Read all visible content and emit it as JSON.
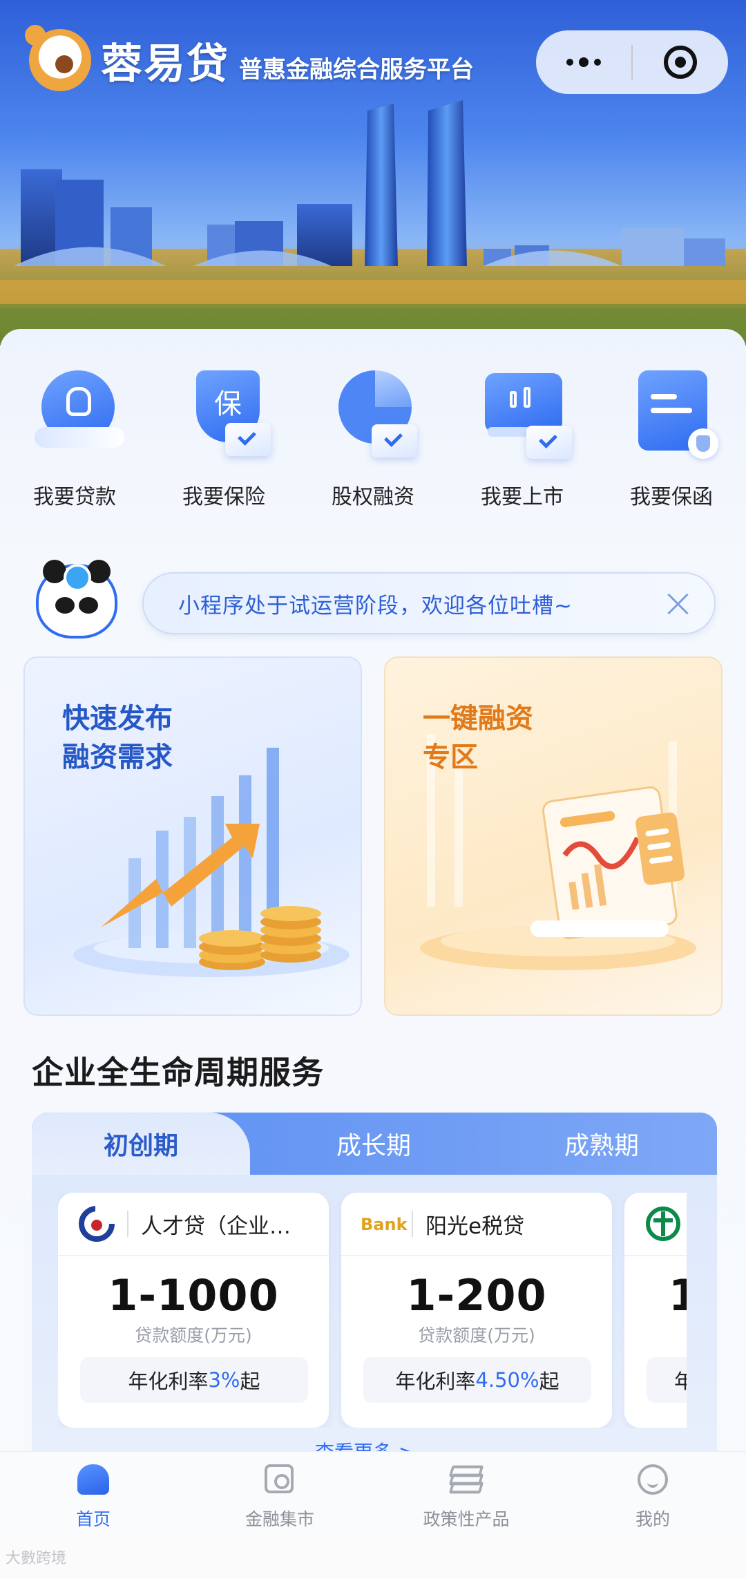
{
  "header": {
    "brand": "蓉易贷",
    "slogan": "普惠金融综合服务平台"
  },
  "capsule": {
    "more_icon": "more-dots-icon",
    "close_icon": "target-circle-icon"
  },
  "quick_actions": [
    {
      "label": "我要贷款",
      "icon": "money-bag-hand-icon"
    },
    {
      "label": "我要保险",
      "icon": "insurance-shield-icon"
    },
    {
      "label": "股权融资",
      "icon": "pie-chart-icon"
    },
    {
      "label": "我要上市",
      "icon": "stock-screen-icon"
    },
    {
      "label": "我要保函",
      "icon": "guarantee-doc-icon"
    }
  ],
  "notice": {
    "text": "小程序处于试运营阶段，欢迎各位吐槽~",
    "close_icon": "close-icon"
  },
  "promos": [
    {
      "title": "快速发布\n融资需求",
      "color": "#2558c6"
    },
    {
      "title": "一键融资\n专区",
      "color": "#e07a1a"
    }
  ],
  "lifecycle": {
    "title": "企业全生命周期服务",
    "tabs": [
      "初创期",
      "成长期",
      "成熟期"
    ],
    "active_tab": "初创期",
    "products": [
      {
        "name": "人才贷（企业…",
        "amount": "1-1000",
        "amount_label": "贷款额度(万元)",
        "rate_prefix": "年化利率",
        "rate": "3%",
        "rate_suffix": "起"
      },
      {
        "name": "阳光e税贷",
        "logo_text": "Bank",
        "amount": "1-200",
        "amount_label": "贷款额度(万元)",
        "rate_prefix": "年化利率",
        "rate": "4.50%",
        "rate_suffix": "起"
      },
      {
        "name": "",
        "amount": "1",
        "amount_label": "",
        "rate_prefix": "年",
        "rate": "",
        "rate_suffix": ""
      }
    ],
    "more_link": "查看更多 >"
  },
  "tabbar": [
    {
      "label": "首页",
      "icon": "home-icon",
      "active": true
    },
    {
      "label": "金融集市",
      "icon": "market-icon",
      "active": false
    },
    {
      "label": "政策性产品",
      "icon": "layers-icon",
      "active": false
    },
    {
      "label": "我的",
      "icon": "profile-icon",
      "active": false
    }
  ],
  "watermark": "大數跨境",
  "colors": {
    "accent": "#2f6cf0",
    "orange": "#e07a1a"
  }
}
